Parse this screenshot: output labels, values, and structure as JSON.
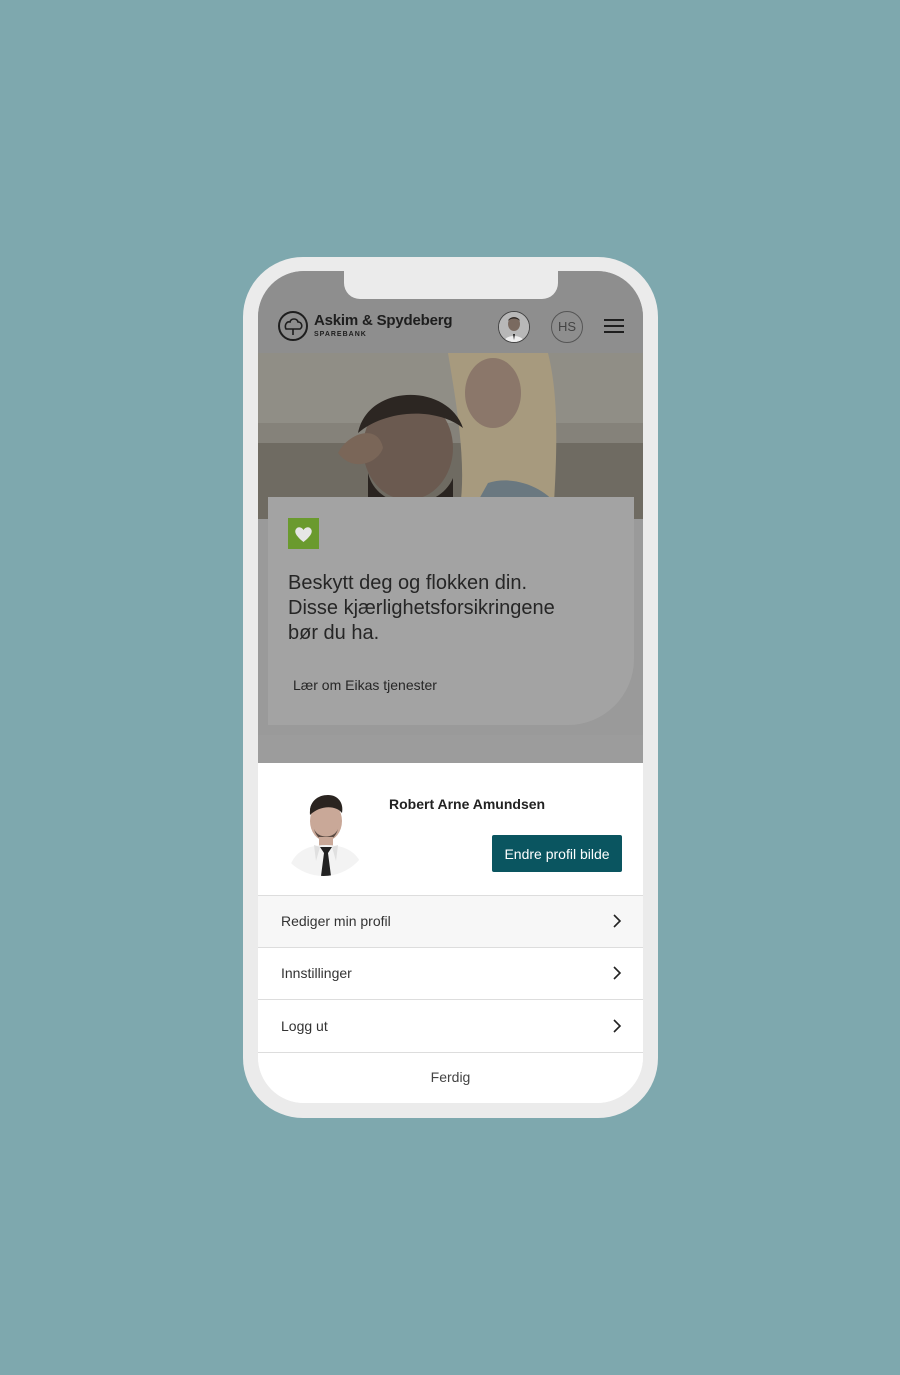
{
  "header": {
    "logo_name": "Askim & Spydeberg",
    "logo_sub": "SPAREBANK",
    "initials": "HS"
  },
  "promo": {
    "title_lines": [
      "Beskytt deg og flokken din.",
      "Disse kjærlighetsforsikringene",
      "bør du ha."
    ],
    "link": "Lær om Eikas tjenester"
  },
  "profile": {
    "name": "Robert Arne Amundsen",
    "change_photo_label": "Endre profil bilde"
  },
  "menu": [
    {
      "label": "Rediger min profil",
      "icon": "chevron-right-icon"
    },
    {
      "label": "Innstillinger",
      "icon": "chevron-right-icon"
    },
    {
      "label": "Logg ut",
      "icon": "chevron-right-icon"
    }
  ],
  "done_label": "Ferdig",
  "colors": {
    "background": "#7ea8ae",
    "button": "#0a5560",
    "heart_badge": "#6a9a2e"
  }
}
